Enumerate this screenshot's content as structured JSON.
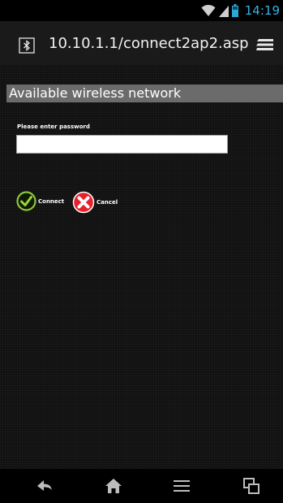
{
  "status_bar": {
    "time": "14:19",
    "icons": [
      "wifi-icon",
      "signal-icon",
      "battery-icon"
    ],
    "accent_color": "#33b5e5"
  },
  "browser": {
    "url": "10.10.1.1/connect2ap2.asp",
    "site_icon": "bluetooth-icon",
    "menu_icon": "stacked-bars-icon"
  },
  "page": {
    "section_title": "Available wireless network",
    "password_label": "Please enter password",
    "password_value": "",
    "connect_label": "Connect",
    "cancel_label": "Cancel"
  },
  "nav_bar": {
    "items": [
      "back-icon",
      "home-icon",
      "menu-icon",
      "tabs-icon"
    ]
  },
  "colors": {
    "connect_green": "#7ab800",
    "cancel_red": "#e8202a",
    "header_gray": "#6b6b6b"
  }
}
